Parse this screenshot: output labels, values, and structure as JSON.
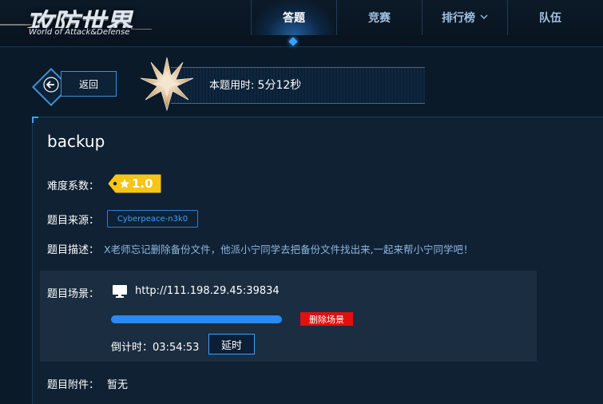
{
  "logo": {
    "main": "攻防世界",
    "sub": "World of Attack&Defense"
  },
  "nav": {
    "items": [
      {
        "label": "答题",
        "active": true
      },
      {
        "label": "竞赛"
      },
      {
        "label": "排行榜",
        "has_dropdown": true
      },
      {
        "label": "队伍"
      }
    ]
  },
  "header": {
    "back_label": "返回",
    "timer_label": "本题用时:",
    "timer_value": "5分12秒"
  },
  "challenge": {
    "title": "backup",
    "difficulty_label": "难度系数：",
    "difficulty_value": "1.0",
    "source_label": "题目来源：",
    "source_value": "Cyberpeace-n3k0",
    "desc_label": "题目描述：",
    "desc_value": "X老师忘记删除备份文件，他派小宁同学去把备份文件找出来,一起来帮小宁同学吧！",
    "scene_label": "题目场景：",
    "scene_url": "http://111.198.29.45:39834",
    "scene_progress": 0.98,
    "delete_label": "删除场景",
    "countdown_label": "倒计时：",
    "countdown_value": "03:54:53",
    "extend_label": "延时",
    "attach_label": "题目附件：",
    "attach_value": "暂无"
  },
  "colors": {
    "accent": "#3ea0ff",
    "danger": "#e20f0f",
    "tag": "#f5c518"
  },
  "icons": [
    "back-arrow-icon",
    "medal-star-icon",
    "star-icon",
    "monitor-icon",
    "chevron-down-icon"
  ]
}
